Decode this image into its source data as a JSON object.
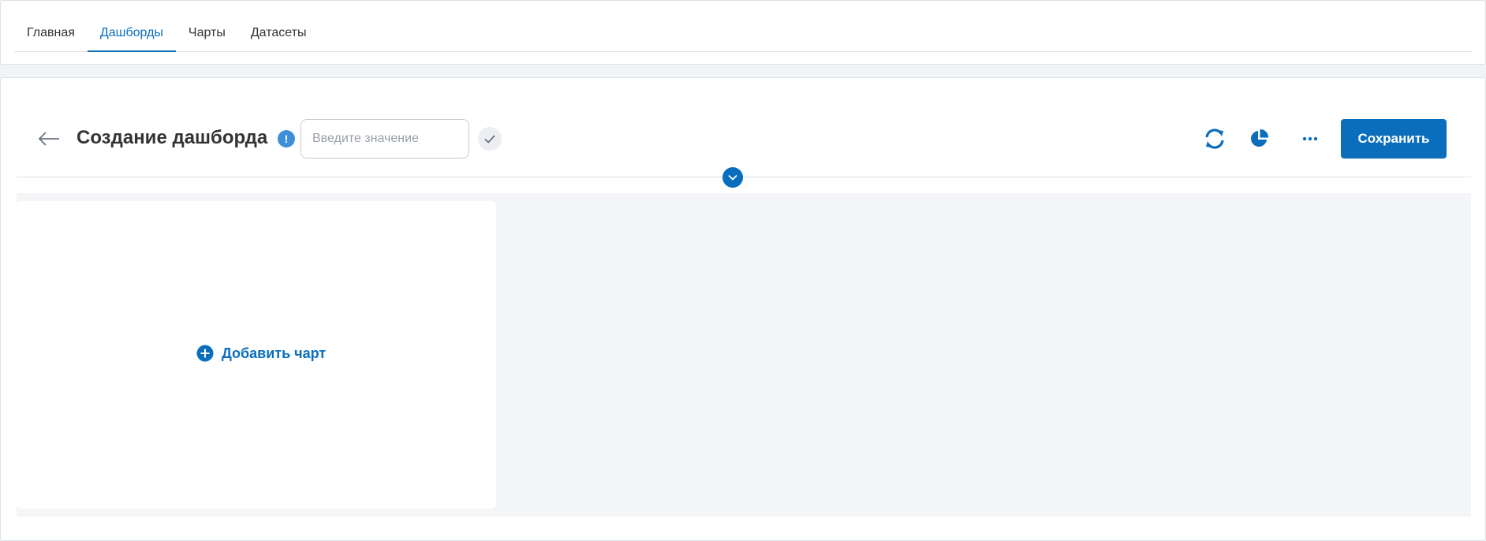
{
  "nav": {
    "tabs": [
      {
        "label": "Главная",
        "active": false
      },
      {
        "label": "Дашборды",
        "active": true
      },
      {
        "label": "Чарты",
        "active": false
      },
      {
        "label": "Датасеты",
        "active": false
      }
    ]
  },
  "header": {
    "title": "Создание дашборда",
    "info_icon_glyph": "!",
    "name_input": {
      "value": "",
      "placeholder": "Введите значение"
    },
    "save_label": "Сохранить"
  },
  "canvas": {
    "add_chart_label": "Добавить чарт"
  },
  "icons": {
    "back": "arrow-left-icon",
    "info": "info-icon",
    "confirm": "check-icon",
    "refresh": "refresh-icon",
    "pie": "pie-chart-icon",
    "more": "more-horizontal-icon",
    "collapse": "chevron-down-icon",
    "add": "plus-circle-icon"
  },
  "colors": {
    "accent": "#0a6ebd",
    "info": "#3f8fd6",
    "text": "#333333",
    "border": "#dde1e6",
    "canvas_bg": "#f4f5f7"
  }
}
